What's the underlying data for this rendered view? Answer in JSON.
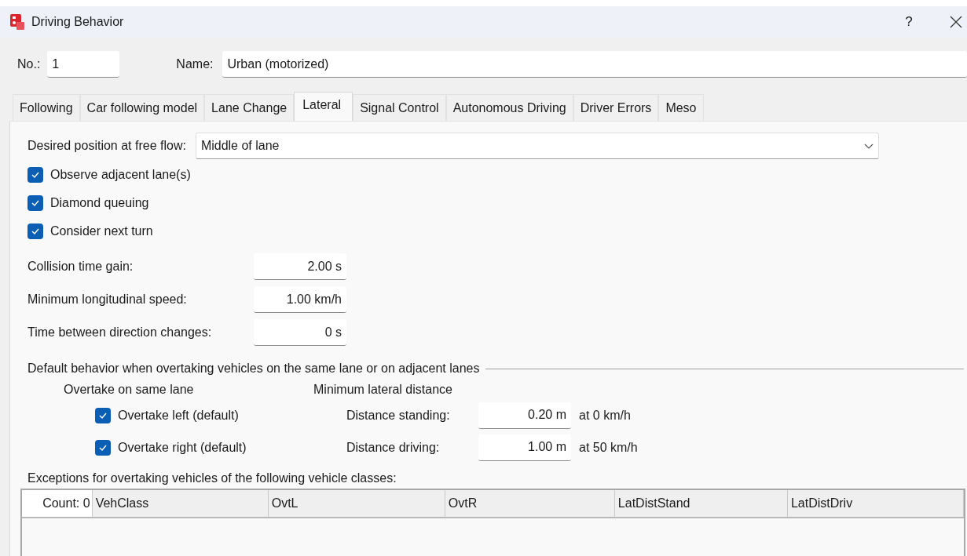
{
  "window": {
    "title": "Driving Behavior",
    "help": "?"
  },
  "header": {
    "number_label": "No.:",
    "number": "1",
    "name_label": "Name:",
    "name": "Urban (motorized)"
  },
  "tabs": [
    {
      "label": "Following",
      "selected": false
    },
    {
      "label": "Car following model",
      "selected": false
    },
    {
      "label": "Lane Change",
      "selected": false
    },
    {
      "label": "Lateral",
      "selected": true
    },
    {
      "label": "Signal Control",
      "selected": false
    },
    {
      "label": "Autonomous Driving",
      "selected": false
    },
    {
      "label": "Driver Errors",
      "selected": false
    },
    {
      "label": "Meso",
      "selected": false
    }
  ],
  "desired_position": {
    "label": "Desired position at free flow:",
    "value": "Middle of lane"
  },
  "options": [
    {
      "label": "Observe adjacent lane(s)",
      "checked": true
    },
    {
      "label": "Diamond queuing",
      "checked": true
    },
    {
      "label": "Consider next turn",
      "checked": true
    }
  ],
  "fields": [
    {
      "label": "Collision time gain:",
      "value": "2.00 s"
    },
    {
      "label": "Minimum longitudinal speed:",
      "value": "1.00 km/h"
    },
    {
      "label": "Time between direction changes:",
      "value": "0 s"
    }
  ],
  "overtaking": {
    "title": "Default behavior when overtaking vehicles on the same lane or on adjacent lanes",
    "same_lane_heading": "Overtake on same lane",
    "distance_heading": "Minimum lateral distance",
    "rows": [
      {
        "option": "Overtake left (default)",
        "checked": true,
        "distance_label": "Distance standing:",
        "distance": "0.20 m",
        "unit": "at 0 km/h"
      },
      {
        "option": "Overtake right (default)",
        "checked": true,
        "distance_label": "Distance driving:",
        "distance": "1.00 m",
        "unit": "at 50 km/h"
      }
    ]
  },
  "exceptions": {
    "label": "Exceptions for overtaking vehicles of the following vehicle classes:",
    "count": "Count: 0",
    "columns": [
      "VehClass",
      "OvtL",
      "OvtR",
      "LatDistStand",
      "LatDistDriv"
    ]
  }
}
